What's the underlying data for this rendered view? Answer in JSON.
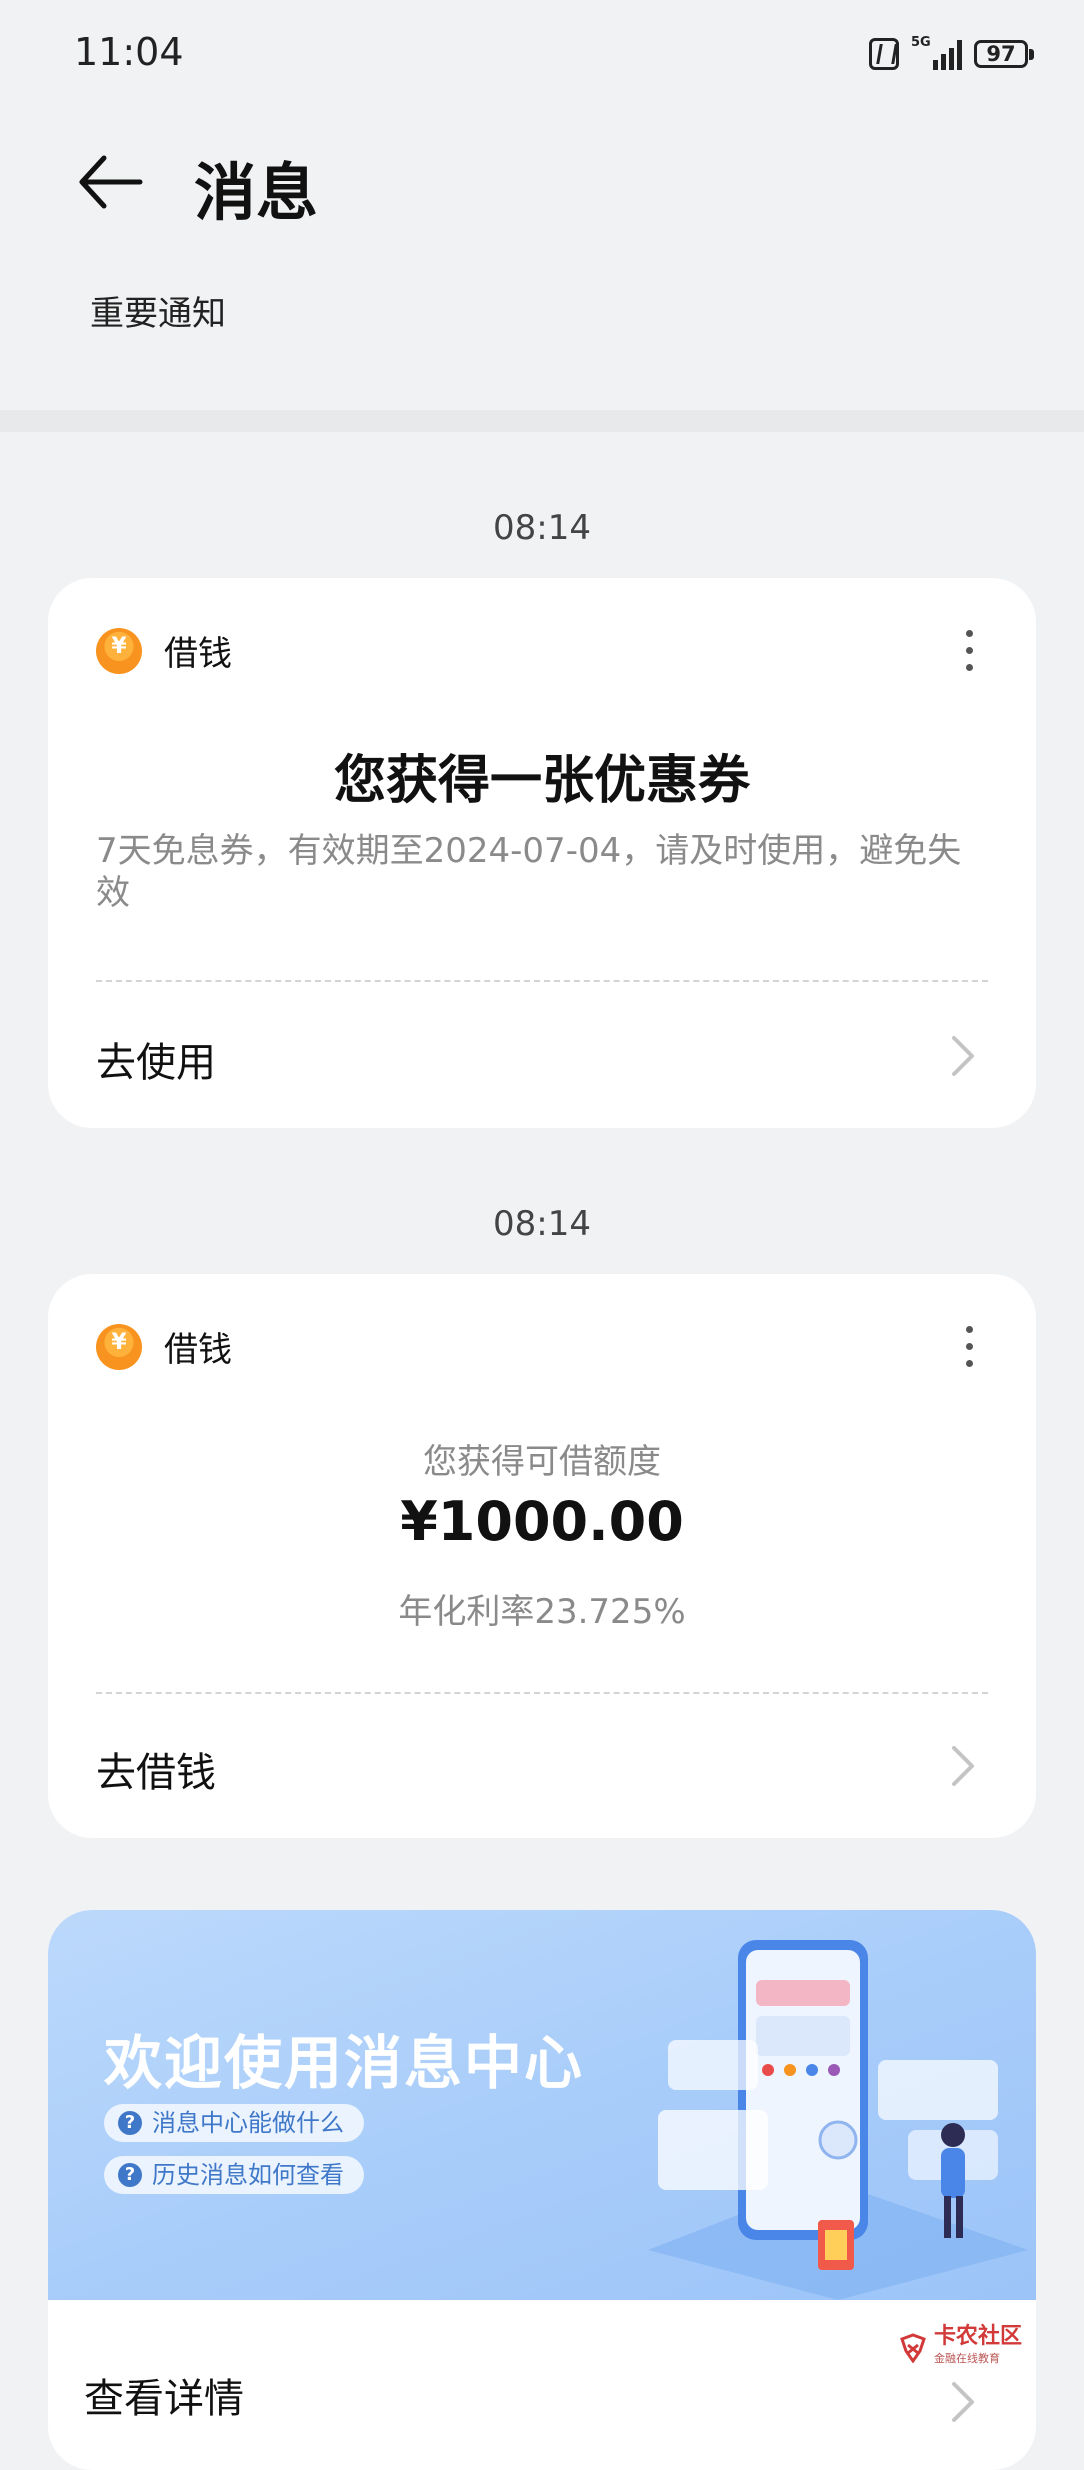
{
  "status_bar": {
    "time": "11:04",
    "network": "5G",
    "battery": "97"
  },
  "header": {
    "title": "消息",
    "subtab": "重要通知"
  },
  "messages": [
    {
      "timestamp": "08:14",
      "app_name": "借钱",
      "title": "您获得一张优惠券",
      "body": "7天免息券，有效期至2024-07-04，请及时使用，避免失效",
      "action": "去使用"
    },
    {
      "timestamp": "08:14",
      "app_name": "借钱",
      "label": "您获得可借额度",
      "amount": "¥1000.00",
      "rate": "年化利率23.725%",
      "action": "去借钱"
    }
  ],
  "banner": {
    "title": "欢迎使用消息中心",
    "links": [
      "消息中心能做什么",
      "历史消息如何查看"
    ],
    "action": "查看详情"
  },
  "watermark": {
    "name": "卡农社区",
    "sub": "金融在线教育"
  },
  "colors": {
    "accent": "#3f78c8",
    "app_icon": "#f7931e",
    "background": "#f1f2f4"
  }
}
